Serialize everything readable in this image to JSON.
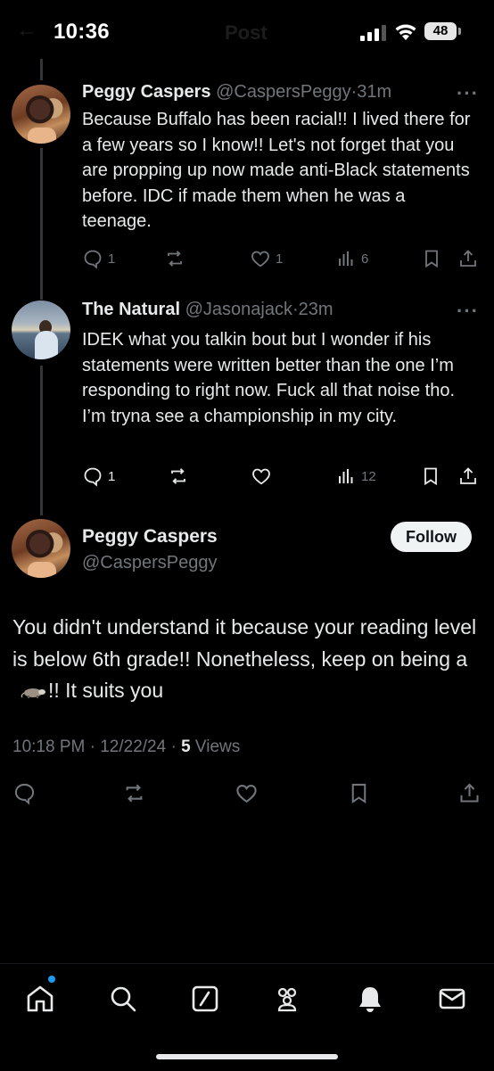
{
  "status_bar": {
    "time": "10:36",
    "battery": "48",
    "ghost_title": "Post",
    "ghost_back": "←"
  },
  "replies": [
    {
      "name": "Peggy Caspers",
      "handle": "@CaspersPeggy",
      "time": "31m",
      "text": "Because Buffalo has been racial!! I lived there for a few years so I know!! Let's not forget that you are propping up  now made anti-Black statements before.  IDC if made them when he was a  teenage.",
      "replies_count": "1",
      "reposts_count": "",
      "likes_count": "1",
      "views_count": "6",
      "avatar_icon": "profile-photo-peggy"
    },
    {
      "name": "The Natural",
      "handle": "@Jasonajack",
      "time": "23m",
      "text": "IDEK what you talkin bout but I wonder if his statements were written better than the one I’m responding to right now. Fuck all that noise tho. I’m tryna see a championship in my city.",
      "replies_count": "1",
      "reposts_count": "",
      "likes_count": "",
      "views_count": "12",
      "avatar_icon": "profile-photo-natural"
    }
  ],
  "main_post": {
    "name": "Peggy Caspers",
    "handle": "@CaspersPeggy",
    "follow_label": "Follow",
    "text_part1": "You didn't understand it because your reading level is below 6th grade!! Nonetheless, keep on being a",
    "emoji_icon": "opossum-emoji",
    "text_part2": "!! It suits you",
    "timestamp": "10:18 PM · 12/22/24 · ",
    "views": "5",
    "views_label": " Views"
  },
  "separator": "·",
  "more_icon": "···",
  "tab_bar": [
    "home-icon",
    "search-icon",
    "grok-icon",
    "communities-icon",
    "notifications-icon",
    "messages-icon"
  ],
  "colors": {
    "background": "#000000",
    "text": "#e7e9ea",
    "muted": "#71767b",
    "accent": "#1d9bf0"
  }
}
